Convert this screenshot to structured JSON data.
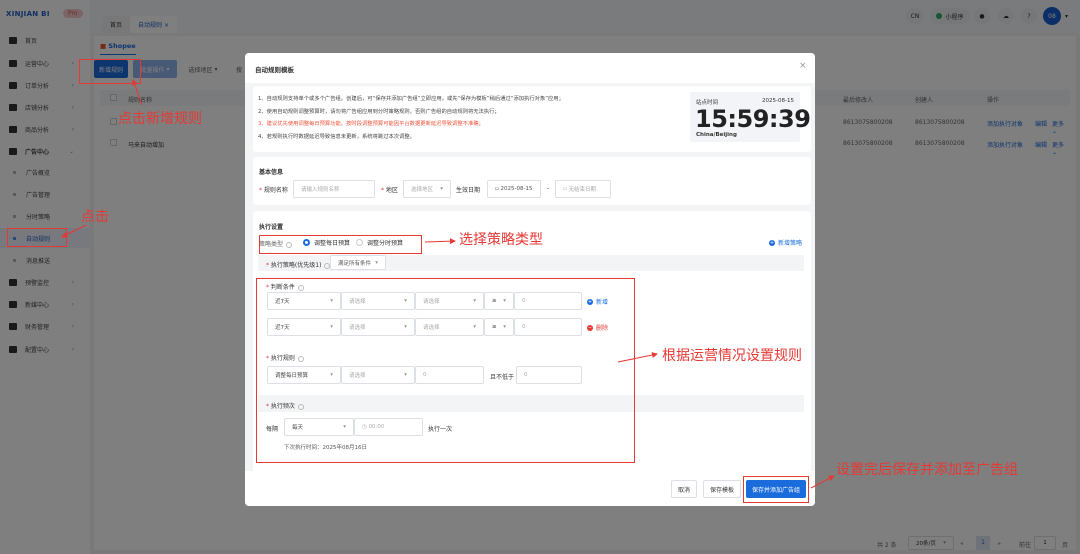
{
  "app": {
    "logo": "XINJIAN BI",
    "badge": "Pro"
  },
  "sidebar": {
    "items": [
      {
        "label": "首页",
        "icon": "home-icon"
      },
      {
        "label": "运营中心",
        "icon": "monitor-icon"
      },
      {
        "label": "订单分析",
        "icon": "bar-chart-icon"
      },
      {
        "label": "店铺分析",
        "icon": "store-icon"
      },
      {
        "label": "商品分析",
        "icon": "product-icon"
      },
      {
        "label": "广告中心",
        "icon": "ad-icon"
      },
      {
        "label": "广告概览"
      },
      {
        "label": "广告管理"
      },
      {
        "label": "分时策略"
      },
      {
        "label": "自动规则"
      },
      {
        "label": "消息推送"
      },
      {
        "label": "预警监控",
        "icon": "pulse-icon"
      },
      {
        "label": "新媒中心",
        "icon": "media-icon"
      },
      {
        "label": "财务管理",
        "icon": "finance-icon"
      },
      {
        "label": "配置中心",
        "icon": "settings-icon"
      }
    ]
  },
  "header": {
    "tabs": [
      {
        "label": "首页"
      },
      {
        "label": "自动规则"
      }
    ],
    "lang": "CN",
    "mini_program": "小程序",
    "avatar": "08"
  },
  "page": {
    "platform": "Shopee",
    "toolbar": {
      "new_rule": "新增规则",
      "batch": "批量操作",
      "region": "选择地区",
      "search": "搜"
    },
    "table": {
      "headers": [
        "规则名称",
        "最后修改人",
        "创建人",
        "操作"
      ],
      "rows": [
        {
          "name": "",
          "modifier": "8613075800208",
          "creator": "8613075800208"
        },
        {
          "name": "马来自动增加",
          "modifier": "8613075800208",
          "creator": "8613075800208"
        }
      ],
      "actions": [
        "添加执行对象",
        "编辑",
        "更多"
      ]
    },
    "pagination": {
      "total": "共 2 条",
      "page_size": "20条/页",
      "current": "1",
      "goto_label": "前往",
      "goto_value": "1",
      "page_unit": "页"
    }
  },
  "modal": {
    "title": "自动规则模板",
    "notes": [
      "1、自动规则支持单个或多个广告组。创建后，可“保存并添加广告组”立即应用，或先“保存为模板”稍后通过“添加执行对象”应用；",
      "2、使用自动规则调整预算时，请勿将广告组应用到分时策略规则，否则广告组的自动规则将无法执行；",
      "3、建议优先使用调整每日预算功能。按时段调整预算可能因平台数据更新延迟导致调整不准确；",
      "4、若规则执行时数据延迟导致信息未更新，系统将跳过本次调整。"
    ],
    "clock": {
      "label": "站点时间",
      "date": "2025-08-15",
      "time": "15:59:39",
      "tz": "China/Beijing"
    },
    "basic": {
      "title": "基本信息",
      "name_label": "规则名称",
      "name_placeholder": "请输入规则名称",
      "region_label": "地区",
      "region_placeholder": "选择地区",
      "date_label": "生效日期",
      "start_date": "2025-08-15",
      "end_placeholder": "无结束日期"
    },
    "exec": {
      "title": "执行设置",
      "strategy_type_label": "策略类型",
      "option_daily": "调整每日预算",
      "option_hourly": "调整分时预算",
      "add_strategy": "新增策略",
      "strategy_label": "执行策略(优先级1)",
      "strategy_match": "满足所有条件",
      "cond_label": "判断条件",
      "conditions": [
        {
          "period": "近7天",
          "metric": "请选择",
          "field": "请选择",
          "op": "≥",
          "value": "0",
          "action": "新增"
        },
        {
          "period": "近7天",
          "metric": "请选择",
          "field": "请选择",
          "op": "≥",
          "value": "0",
          "action": "删除"
        }
      ],
      "rule_label": "执行规则",
      "rule_action": "调整每日预算",
      "rule_select": "请选择",
      "rule_value": "0",
      "min_label": "且不低于",
      "min_value": "0",
      "freq_label": "执行频次",
      "every_label": "每隔",
      "every_value": "每天",
      "time_placeholder": "00:00",
      "once_label": "执行一次",
      "next_run": "下次执行时间：2025年08月16日"
    },
    "footer": {
      "cancel": "取消",
      "save_template": "保存模板",
      "save_apply": "保存并添加广告组"
    }
  },
  "annotations": {
    "click_new": "点击新增规则",
    "click": "点击",
    "choose_type": "选择策略类型",
    "set_rules": "根据运营情况设置规则",
    "save_apply": "设置完后保存并添加至广告组"
  },
  "colors": {
    "primary": "#1a6bdc",
    "annotation": "#e53935",
    "warning_note": "#f0533b"
  }
}
